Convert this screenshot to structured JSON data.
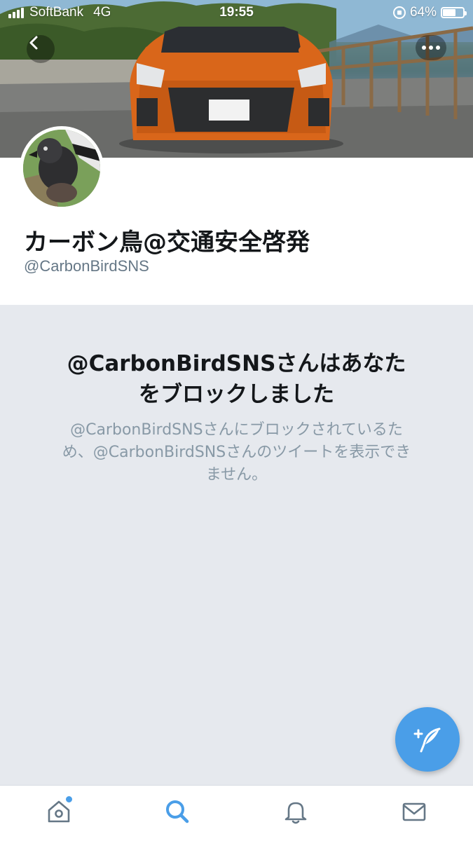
{
  "status_bar": {
    "carrier": "SoftBank",
    "network": "4G",
    "time": "19:55",
    "battery_percent": "64%",
    "battery_level": 0.64
  },
  "header": {
    "back_icon": "chevron-left-icon",
    "more_icon": "more-horizontal-icon"
  },
  "profile": {
    "display_name": "カーボン鳥@交通安全啓発",
    "handle": "@CarbonBirdSNS"
  },
  "blocked": {
    "title_line1": "@CarbonBirdSNSさんはあなた",
    "title_line2": "をブロックしました",
    "desc_line1": "@CarbonBirdSNSさんにブロックされているた",
    "desc_line2": "め、@CarbonBirdSNSさんのツイートを表示でき",
    "desc_line3": "ません。"
  },
  "tabs": [
    {
      "icon": "home-icon",
      "active": false,
      "has_dot": true
    },
    {
      "icon": "search-icon",
      "active": true,
      "has_dot": false
    },
    {
      "icon": "bell-icon",
      "active": false,
      "has_dot": false
    },
    {
      "icon": "mail-icon",
      "active": false,
      "has_dot": false
    }
  ],
  "colors": {
    "accent": "#4a9ee8",
    "title": "#14171a",
    "secondary": "#657786",
    "muted": "#8899a6",
    "background": "#e6e9ee",
    "car": "#d9661a"
  }
}
